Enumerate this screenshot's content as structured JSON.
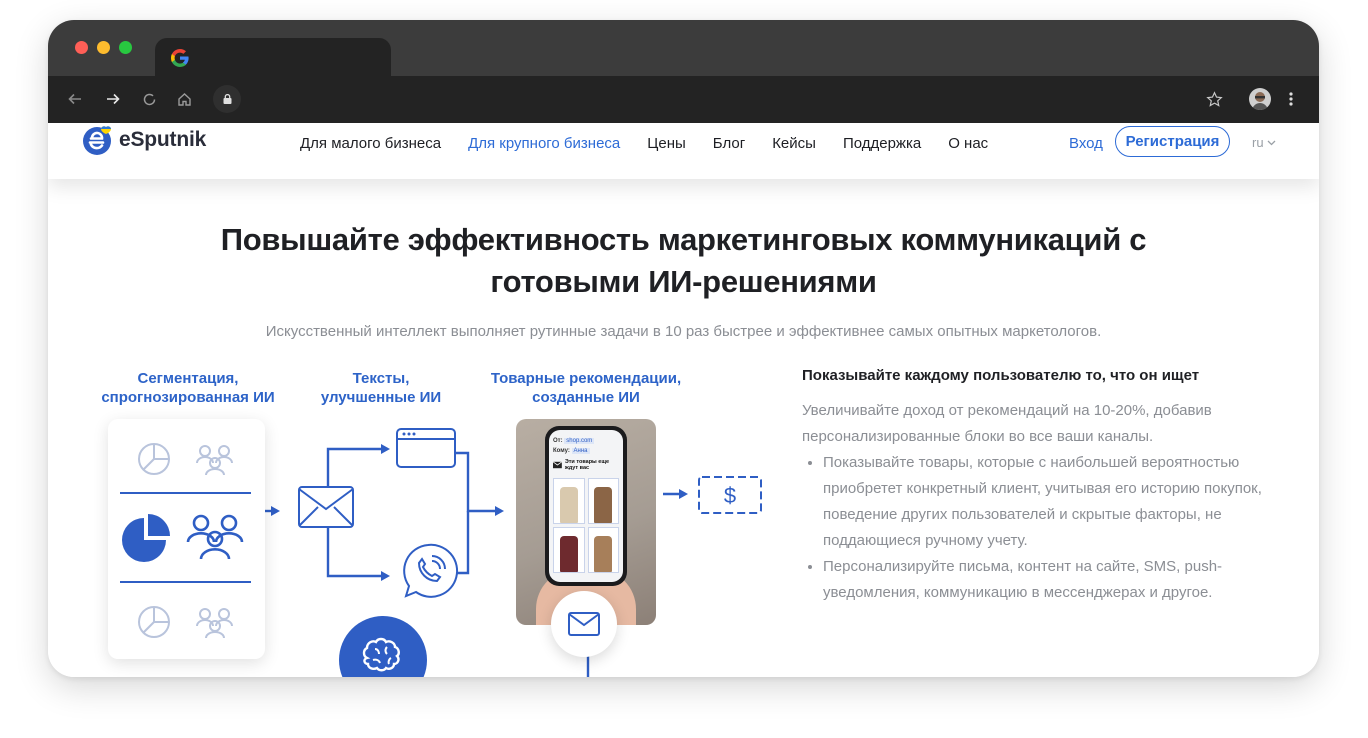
{
  "browser": {
    "window_controls": [
      "close",
      "minimize",
      "maximize"
    ],
    "tab_icon": "google-g-icon",
    "toolbar_icons": [
      "back-arrow-icon",
      "forward-arrow-icon",
      "reload-icon",
      "home-icon",
      "lock-icon",
      "star-icon",
      "avatar",
      "more-vert-icon"
    ]
  },
  "site": {
    "logo_text": "eSputnik",
    "nav": [
      {
        "label": "Для малого бизнеса",
        "active": false
      },
      {
        "label": "Для крупного бизнеса",
        "active": true
      },
      {
        "label": "Цены",
        "active": false
      },
      {
        "label": "Блог",
        "active": false
      },
      {
        "label": "Кейсы",
        "active": false
      },
      {
        "label": "Поддержка",
        "active": false
      },
      {
        "label": "О нас",
        "active": false
      }
    ],
    "login_label": "Вход",
    "register_label": "Регистрация",
    "lang_label": "ru"
  },
  "hero": {
    "title_line1": "Повышайте эффективность маркетинговых коммуникаций с",
    "title_line2": "готовыми ИИ-решениями",
    "subtitle": "Искусственный интеллект выполняет рутинные задачи в 10 раз быстрее и эффективнее самых опытных маркетологов."
  },
  "diagram": {
    "labels": [
      {
        "line1": "Сегментация,",
        "line2": "спрогнозированная ИИ"
      },
      {
        "line1": "Тексты,",
        "line2": "улучшенные ИИ"
      },
      {
        "line1": "Товарные рекомендации,",
        "line2": "созданные ИИ"
      }
    ],
    "phone": {
      "from_label": "От:",
      "from_value": "shop.com",
      "to_label": "Кому:",
      "to_value": "Анна",
      "message": "Эти товары еще ждут вас"
    }
  },
  "feature": {
    "title": "Показывайте каждому пользователю то, что он ищет",
    "text": "Увеличивайте доход от рекомендаций на 10-20%, добавив персонализированные блоки во все ваши каналы.",
    "bullets": [
      "Показывайте товары, которые с наибольшей вероятностью приобретет конкретный клиент, учитывая его историю покупок, поведение других пользователей и скрытые факторы, не поддающиеся ручному учету.",
      "Персонализируйте письма, контент на сайте, SMS, push-уведомления, коммуникацию в мессенджерах и другое."
    ]
  },
  "colors": {
    "accent": "#2d6bd6",
    "diagram_blue": "#2f5ec4",
    "muted_text": "#8b8e94"
  }
}
